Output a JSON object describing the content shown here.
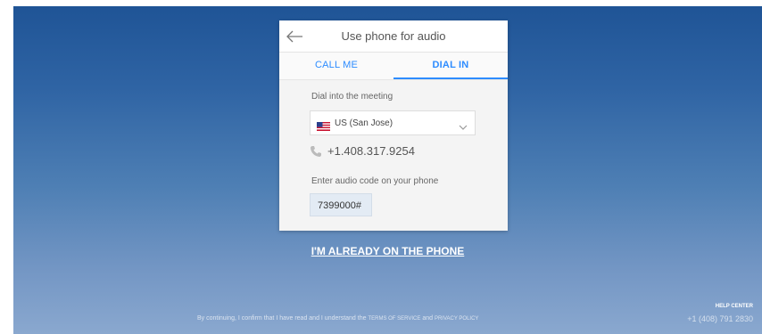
{
  "dialog": {
    "title": "Use phone for audio",
    "back_icon": "arrow-left-icon"
  },
  "tabs": [
    {
      "label": "CALL ME",
      "active": false
    },
    {
      "label": "DIAL IN",
      "active": true
    }
  ],
  "dial_in": {
    "dial_label": "Dial into the meeting",
    "country_selected": "US (San Jose)",
    "country_flag": "us-flag-icon",
    "phone_number": "+1.408.317.9254",
    "code_label": "Enter audio code on your phone",
    "audio_code": "7399000#"
  },
  "already_on_phone": "I'M ALREADY ON THE PHONE",
  "footer": {
    "text": "By continuing, I confirm that I have read and I understand the",
    "terms": "TERMS OF SERVICE",
    "and": "and",
    "privacy": "PRIVACY POLICY"
  },
  "help": {
    "label": "HELP CENTER",
    "phone": "+1 (408) 791 2830"
  },
  "colors": {
    "accent": "#2d8cff",
    "background_top": "#1f5496",
    "background_bottom": "#8aa8cf"
  }
}
